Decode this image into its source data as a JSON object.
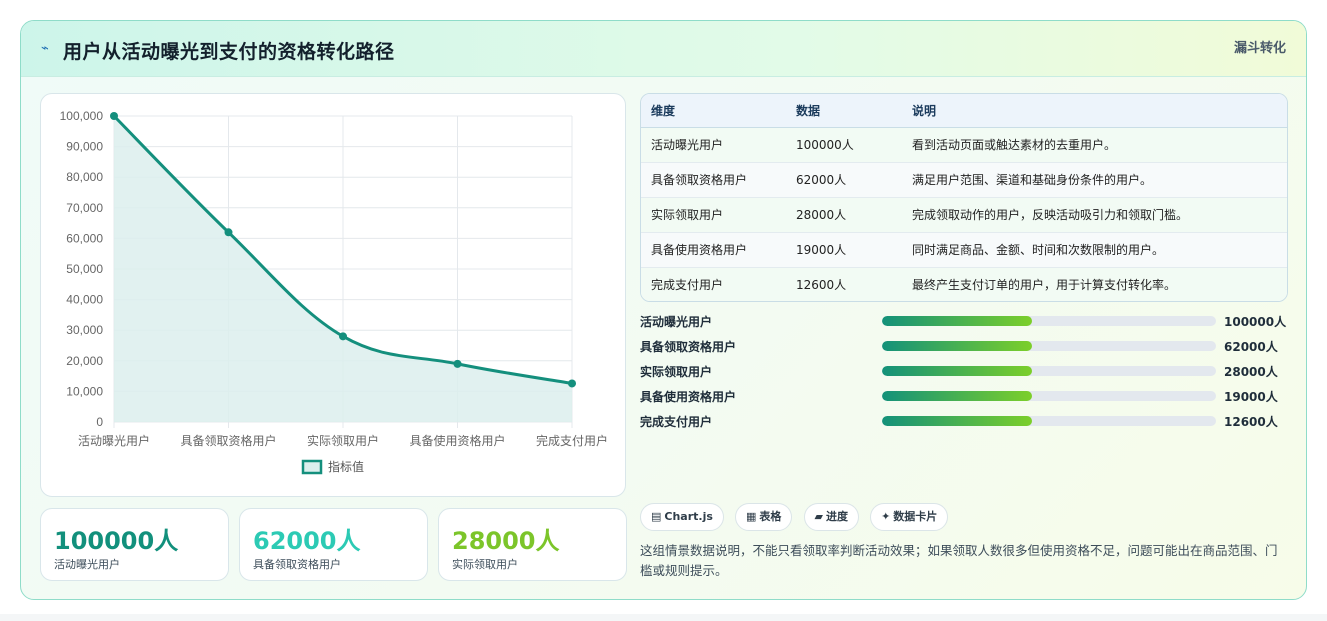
{
  "header": {
    "icon": "⌁",
    "title": "用户从活动曝光到支付的资格转化路径",
    "tag": "漏斗转化"
  },
  "chart_data": {
    "type": "line",
    "categories": [
      "活动曝光用户",
      "具备领取资格用户",
      "实际领取用户",
      "具备使用资格用户",
      "完成支付用户"
    ],
    "series": [
      {
        "name": "指标值",
        "values": [
          100000,
          62000,
          28000,
          19000,
          12600
        ]
      }
    ],
    "yticks": [
      "0",
      "10,000",
      "20,000",
      "30,000",
      "40,000",
      "50,000",
      "60,000",
      "70,000",
      "80,000",
      "90,000",
      "100,000"
    ],
    "ylim": [
      0,
      100000
    ],
    "grid": true,
    "fill": true,
    "legend": "bottom",
    "colors": {
      "line": "#148f7d",
      "fill": "#dcefed"
    }
  },
  "table": {
    "headers": [
      "维度",
      "数据",
      "说明"
    ],
    "rows": [
      [
        "活动曝光用户",
        "100000人",
        "看到活动页面或触达素材的去重用户。"
      ],
      [
        "具备领取资格用户",
        "62000人",
        "满足用户范围、渠道和基础身份条件的用户。"
      ],
      [
        "实际领取用户",
        "28000人",
        "完成领取动作的用户，反映活动吸引力和领取门槛。"
      ],
      [
        "具备使用资格用户",
        "19000人",
        "同时满足商品、金额、时间和次数限制的用户。"
      ],
      [
        "完成支付用户",
        "12600人",
        "最终产生支付订单的用户，用于计算支付转化率。"
      ]
    ]
  },
  "progress": [
    {
      "label": "活动曝光用户",
      "value": "100000人",
      "fraction": 0.45
    },
    {
      "label": "具备领取资格用户",
      "value": "62000人",
      "fraction": 0.45
    },
    {
      "label": "实际领取用户",
      "value": "28000人",
      "fraction": 0.45
    },
    {
      "label": "具备使用资格用户",
      "value": "19000人",
      "fraction": 0.45
    },
    {
      "label": "完成支付用户",
      "value": "12600人",
      "fraction": 0.45
    }
  ],
  "chips": [
    {
      "icon": "▤",
      "label": "Chart.js"
    },
    {
      "icon": "▦",
      "label": "表格"
    },
    {
      "icon": "▰",
      "label": "进度"
    },
    {
      "icon": "✦",
      "label": "数据卡片"
    }
  ],
  "note": "这组情景数据说明，不能只看领取率判断活动效果；如果领取人数很多但使用资格不足，问题可能出在商品范围、门槛或规则提示。",
  "stats": [
    {
      "value": "100000人",
      "label": "活动曝光用户",
      "color": "#12907c"
    },
    {
      "value": "62000人",
      "label": "具备领取资格用户",
      "color": "#2ccab4"
    },
    {
      "value": "28000人",
      "label": "实际领取用户",
      "color": "#7cc52a"
    }
  ]
}
